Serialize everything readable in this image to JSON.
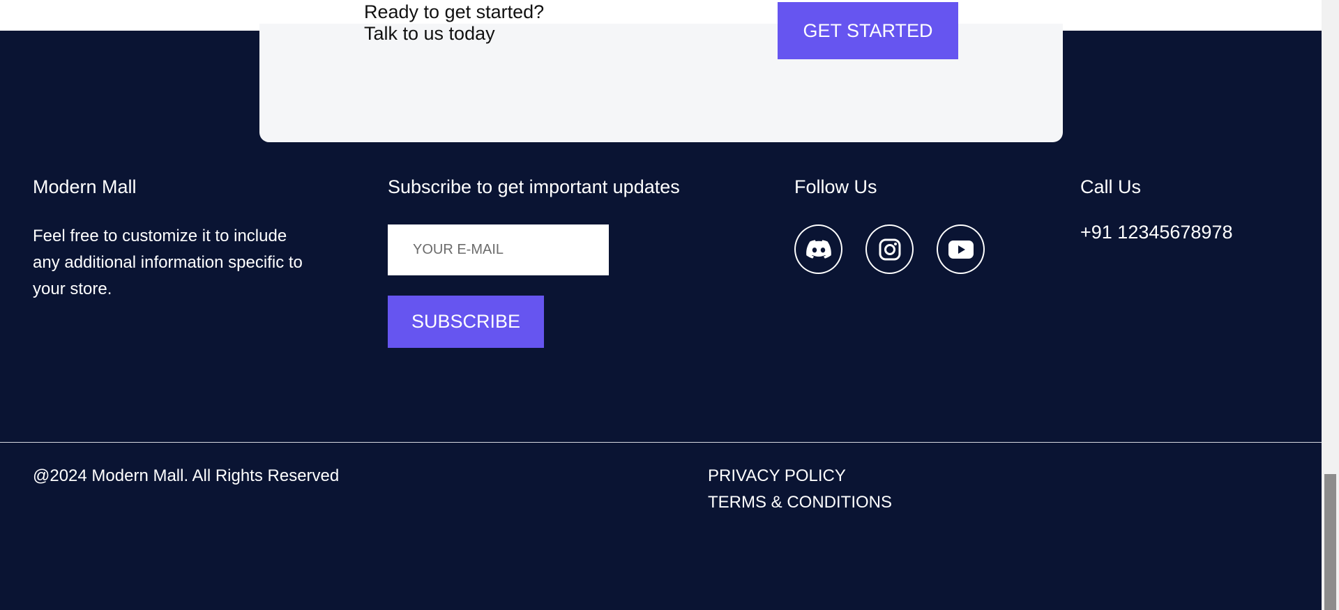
{
  "cta": {
    "line1": "Ready to get started?",
    "line2": "Talk to us today",
    "button_label": "GET STARTED"
  },
  "brand": {
    "title": "Modern Mall",
    "description": "Feel free to customize it to include any additional information specific to your store."
  },
  "subscribe": {
    "title": "Subscribe to get important updates",
    "placeholder": "YOUR E-MAIL",
    "button_label": "SUBSCRIBE"
  },
  "follow": {
    "title": "Follow Us",
    "icons": [
      "discord-icon",
      "instagram-icon",
      "youtube-icon"
    ]
  },
  "call": {
    "title": "Call Us",
    "phone": "+91 12345678978"
  },
  "bottom": {
    "copyright": "@2024 Modern Mall. All Rights Reserved",
    "privacy": "PRIVACY POLICY",
    "terms": "TERMS & CONDITIONS"
  },
  "colors": {
    "footer_bg": "#0a1433",
    "accent": "#6655f0",
    "card_bg": "#f5f6f8"
  }
}
